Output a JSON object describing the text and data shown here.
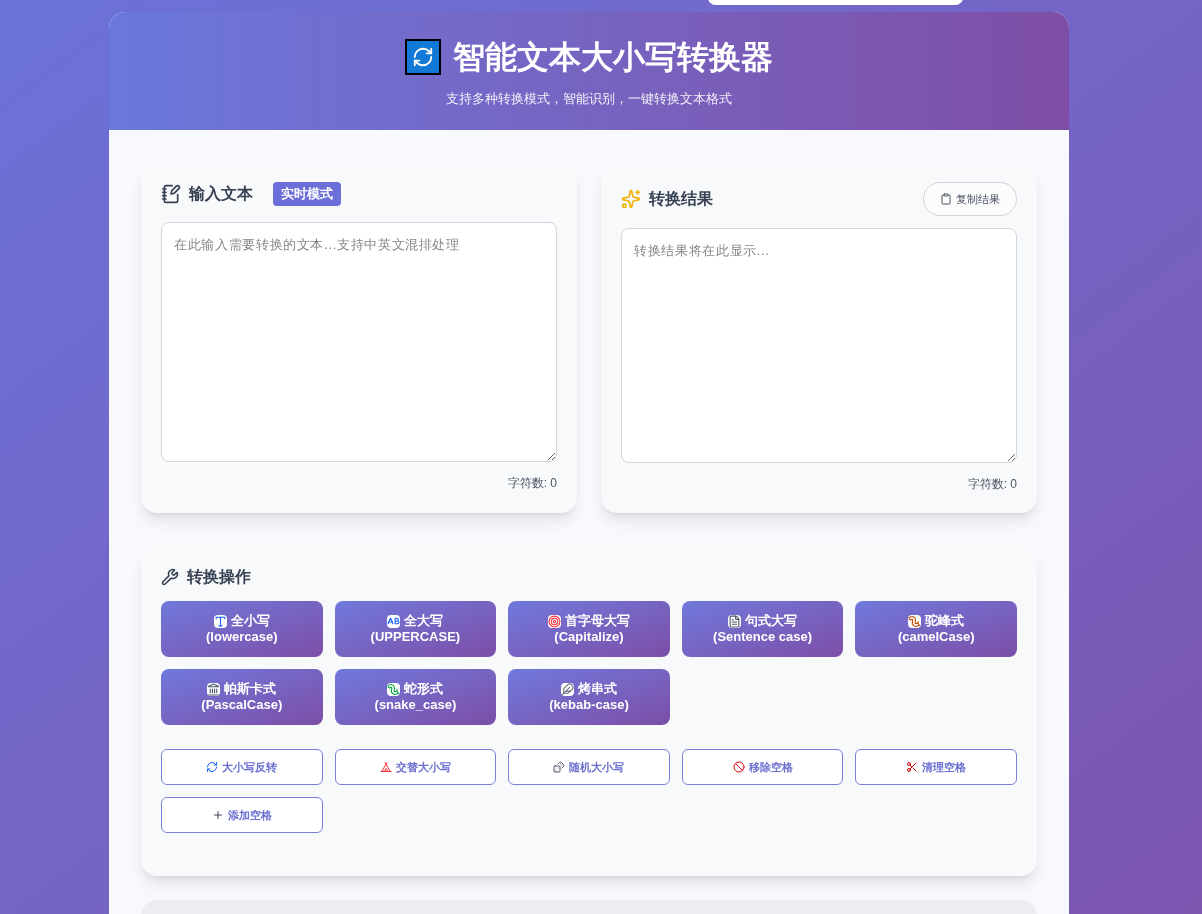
{
  "header": {
    "title": "智能文本大小写转换器",
    "subtitle": "支持多种转换模式，智能识别，一键转换文本格式"
  },
  "input_panel": {
    "title": "输入文本",
    "badge": "实时模式",
    "placeholder": "在此输入需要转换的文本...支持中英文混排处理",
    "count": "字符数: 0"
  },
  "output_panel": {
    "title": "转换结果",
    "copy_button": "复制结果",
    "placeholder": "转换结果将在此显示...",
    "count": "字符数: 0"
  },
  "operations": {
    "title": "转换操作",
    "primary_buttons": [
      {
        "label": "全小写",
        "sub": "(lowercase)"
      },
      {
        "label": "全大写",
        "sub": "(UPPERCASE)"
      },
      {
        "label": "首字母大写",
        "sub": "(Capitalize)"
      },
      {
        "label": "句式大写",
        "sub": "(Sentence case)"
      },
      {
        "label": "驼峰式",
        "sub": "(camelCase)"
      },
      {
        "label": "帕斯卡式",
        "sub": "(PascalCase)"
      },
      {
        "label": "蛇形式",
        "sub": "(snake_case)"
      },
      {
        "label": "烤串式",
        "sub": "(kebab-case)"
      }
    ],
    "secondary_buttons": [
      "大小写反转",
      "交替大小写",
      "随机大小写",
      "移除空格",
      "清理空格",
      "添加空格"
    ]
  }
}
